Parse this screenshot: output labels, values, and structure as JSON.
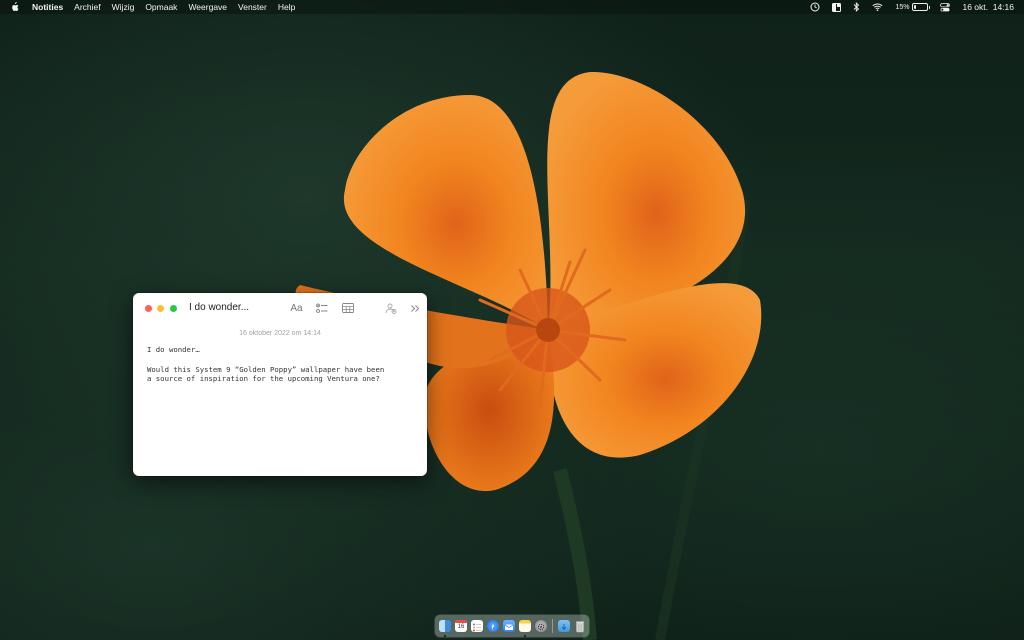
{
  "menubar": {
    "apple_icon": "apple-logo-icon",
    "app_name": "Notities",
    "items": [
      "Archief",
      "Wijzig",
      "Opmaak",
      "Weergave",
      "Venster",
      "Help"
    ],
    "status": {
      "icons": [
        "clock-icon",
        "sidebar-icon",
        "bluetooth-icon",
        "wifi-icon",
        "control-center-icon"
      ],
      "battery_percent": "15%",
      "battery_level": 0.15,
      "datetime": "16 okt.  14:16"
    }
  },
  "note_window": {
    "title": "I do wonder...",
    "toolbar": {
      "format_label": "Aa"
    },
    "date": "16 oktober 2022 om 14:14",
    "body": {
      "line1": "I do wonder…",
      "line2": "Would this System 9 “Golden Poppy” wallpaper have been",
      "line3": "a source of inspiration for the upcoming Ventura one?"
    }
  },
  "dock": {
    "apps": [
      "finder",
      "calendar",
      "reminders",
      "safari",
      "mail",
      "notes",
      "system-settings",
      "downloads",
      "trash"
    ],
    "calendar_day": "16",
    "colors": {
      "finder": "#3d8ce0",
      "safari": "#2c7ee8",
      "mail": "#3b8ef0",
      "notes": "#f6d44a",
      "system_settings": "#8e8e93"
    }
  },
  "colors": {
    "poppy_orange": "#f08a22",
    "traffic_close": "#ff5f57",
    "traffic_min": "#febc2e",
    "traffic_max": "#28c840"
  }
}
